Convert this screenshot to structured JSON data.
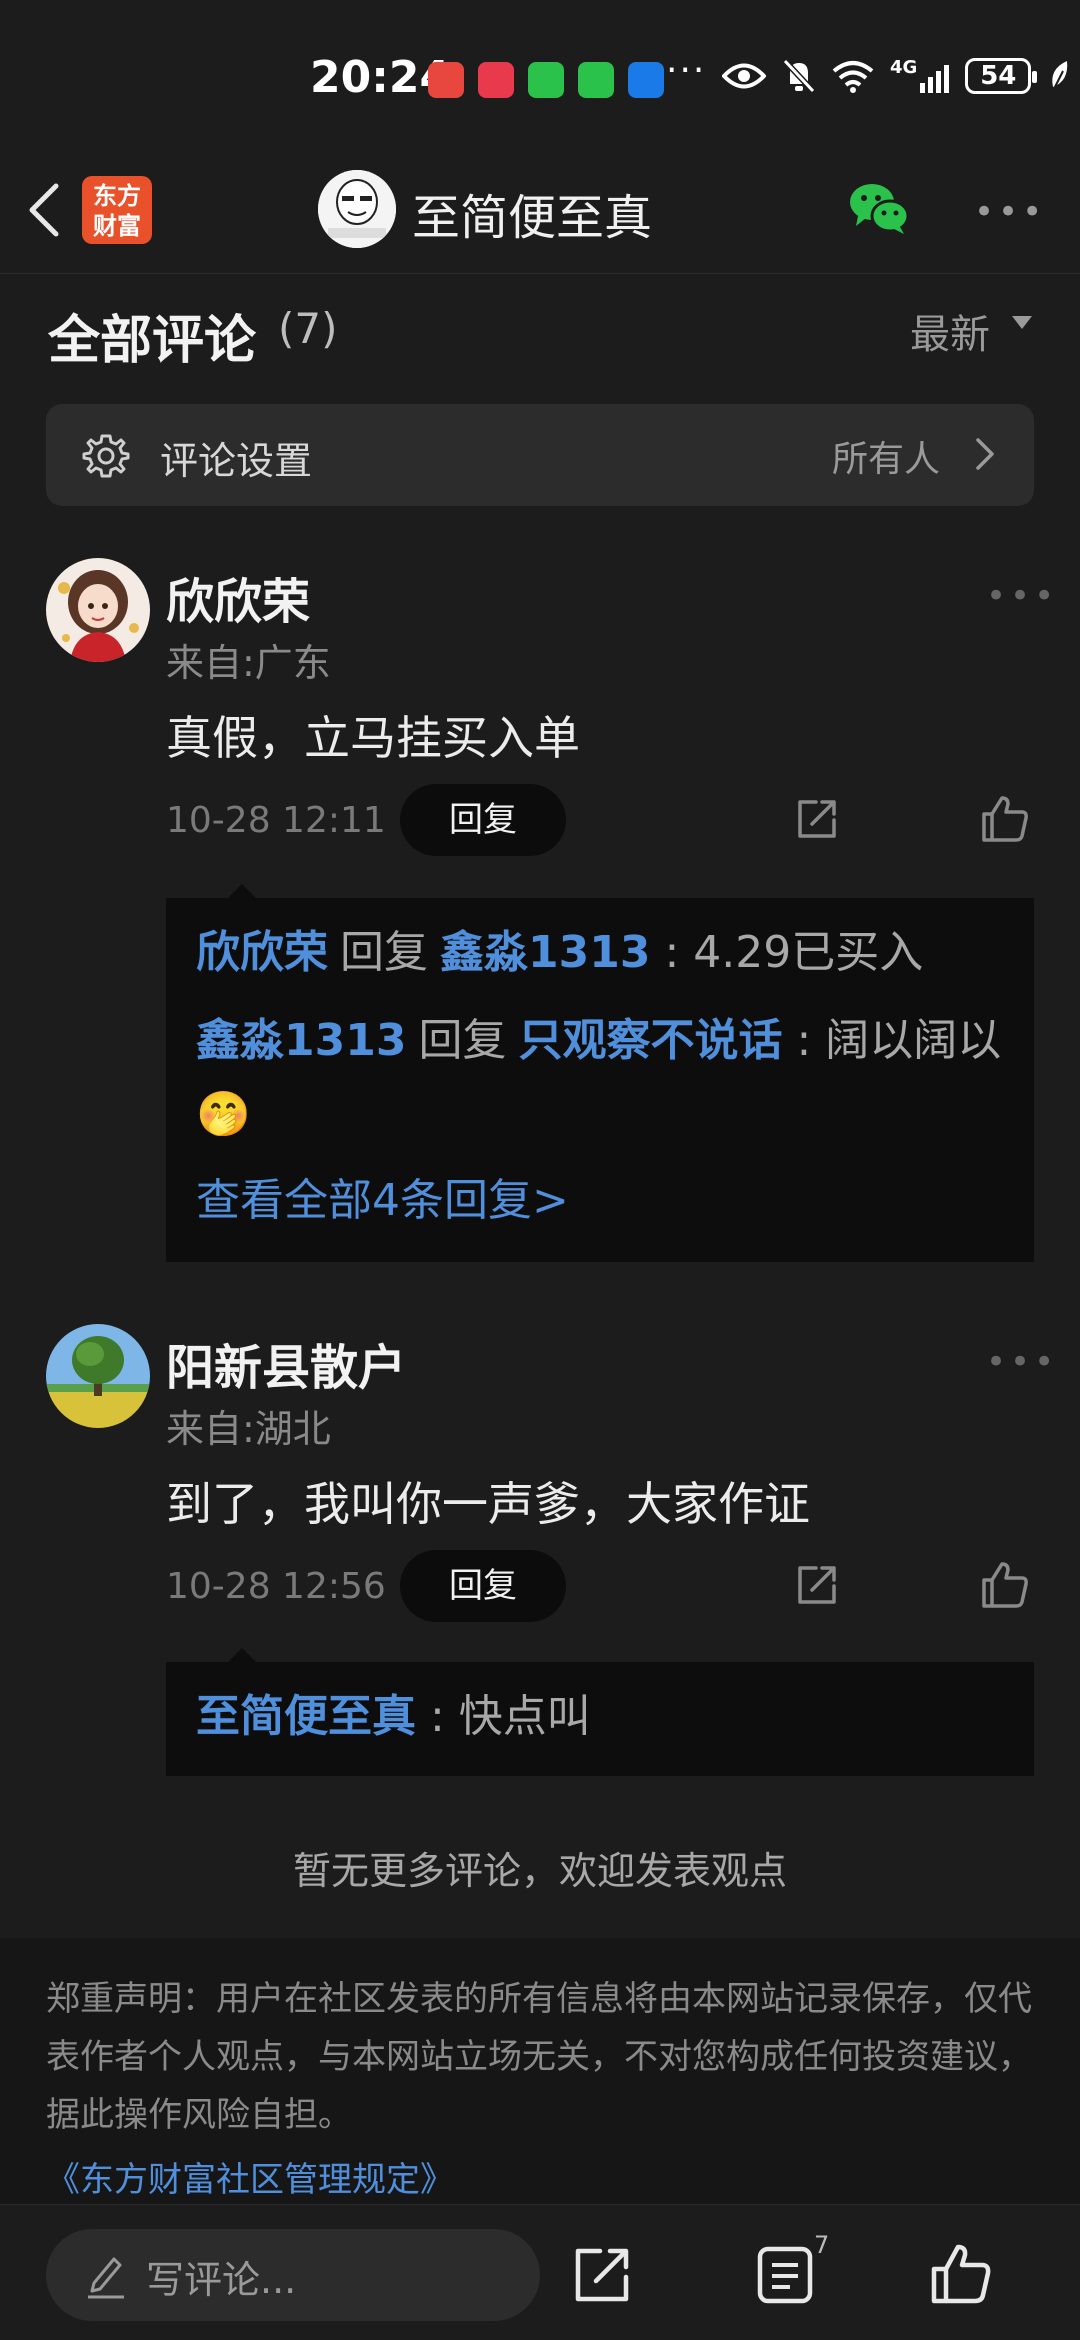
{
  "status": {
    "time": "20:24",
    "battery": "54",
    "network": "4G",
    "app_icons": [
      {
        "name": "missed-call-icon",
        "color": "#e8473f"
      },
      {
        "name": "xiaohongshu-icon",
        "color": "#e83a4c"
      },
      {
        "name": "wechat-icon",
        "color": "#2bc24b"
      },
      {
        "name": "wechat-icon",
        "color": "#2bc24b"
      },
      {
        "name": "app-icon",
        "color": "#1a7be8"
      }
    ],
    "more": "···"
  },
  "header": {
    "brand_line1": "东方",
    "brand_line2": "财富",
    "title": "至简便至真"
  },
  "comments_section": {
    "title": "全部评论",
    "count": "(7)",
    "sort": "最新",
    "settings_label": "评论设置",
    "settings_value": "所有人"
  },
  "comments": [
    {
      "name": "欣欣荣",
      "location": "来自:广东",
      "text": "真假，立马挂买入单",
      "time": "10-28 12:11",
      "reply_label": "回复",
      "replies": [
        {
          "from": "欣欣荣",
          "verb": "回复",
          "to": "鑫淼1313",
          "text": ": 4.29已买入"
        },
        {
          "from": "鑫淼1313",
          "verb": "回复",
          "to": "只观察不说话",
          "text": ": 阔以阔以🤭"
        }
      ],
      "view_all": "查看全部4条回复>"
    },
    {
      "name": "阳新县散户",
      "location": "来自:湖北",
      "text": "到了，我叫你一声爹，大家作证",
      "time": "10-28 12:56",
      "reply_label": "回复",
      "replies": [
        {
          "from": "至简便至真",
          "text": ": 快点叫"
        }
      ]
    }
  ],
  "footer": {
    "no_more": "暂无更多评论，欢迎发表观点",
    "disclaimer": "郑重声明：用户在社区发表的所有信息将由本网站记录保存，仅代表作者个人观点，与本网站立场无关，不对您构成任何投资建议，据此操作风险自担。",
    "rules_link": "《东方财富社区管理规定》"
  },
  "bottom_bar": {
    "write_placeholder": "写评论...",
    "comment_count": "7"
  },
  "colors": {
    "background": "#1c1c1c",
    "link_blue": "#4f8fdc",
    "brand_orange": "#e8512a",
    "wechat_green": "#2bc24b"
  }
}
